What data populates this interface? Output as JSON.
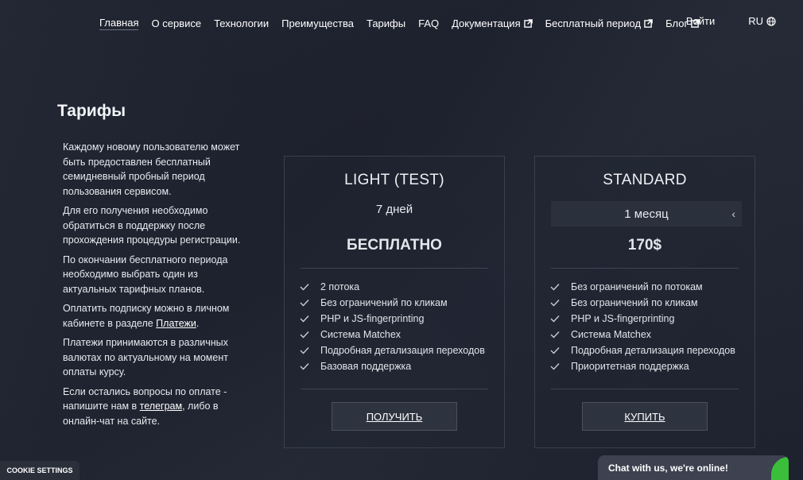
{
  "nav": {
    "items": [
      {
        "label": "Главная",
        "external": false,
        "active": true
      },
      {
        "label": "О сервисе",
        "external": false,
        "active": false
      },
      {
        "label": "Технологии",
        "external": false,
        "active": false
      },
      {
        "label": "Преимущества",
        "external": false,
        "active": false
      },
      {
        "label": "Тарифы",
        "external": false,
        "active": false
      },
      {
        "label": "FAQ",
        "external": false,
        "active": false
      },
      {
        "label": "Документация",
        "external": true,
        "active": false
      },
      {
        "label": "Бесплатный период",
        "external": true,
        "active": false
      },
      {
        "label": "Блог",
        "external": true,
        "active": false
      }
    ],
    "login": "Войти",
    "lang": "RU"
  },
  "page": {
    "title": "Тарифы"
  },
  "info": {
    "p1": "Каждому новому пользователю может быть предоставлен бесплатный семидневный пробный период пользования сервисом.",
    "p2": "Для его получения необходимо обратиться в поддержку после прохождения процедуры регистрации.",
    "p3": "По окончании бесплатного периода необходимо выбрать один из актуальных тарифных планов.",
    "p4_before": "Оплатить подписку можно в личном кабинете в разделе ",
    "p4_link": "Платежи",
    "p4_after": ".",
    "p5": "Платежи принимаются в различных валютах по актуальному на момент оплаты курсу.",
    "p6_before": "Если остались вопросы по оплате - напишите нам в ",
    "p6_link": "телеграм",
    "p6_after": ", либо в онлайн-чат на сайте."
  },
  "plans": {
    "light": {
      "name": "LIGHT (TEST)",
      "period": "7 дней",
      "price": "БЕСПЛАТНО",
      "features": [
        "2 потока",
        "Без ограничений по кликам",
        "PHP и JS-fingerprinting",
        "Система Matchex",
        "Подробная детализация переходов",
        "Базовая поддержка"
      ],
      "button": "ПОЛУЧИТЬ"
    },
    "standard": {
      "name": "STANDARD",
      "period": "1 месяц",
      "price": "170$",
      "features": [
        "Без ограничений по потокам",
        "Без ограничений по кликам",
        "PHP и JS-fingerprinting",
        "Система Matchex",
        "Подробная детализация переходов",
        "Приоритетная поддержка"
      ],
      "button": "КУПИТЬ"
    }
  },
  "cookie": "COOKIE SETTINGS",
  "chat": "Chat with us, we're online!",
  "colors": {
    "background": "#1f2330",
    "card_border": "#3a3f4d",
    "chat_status": "#3bbf3b"
  },
  "icons": {
    "external": "external-link-icon",
    "globe": "globe-icon",
    "check": "check-icon",
    "chevron": "chevron-left-icon"
  }
}
